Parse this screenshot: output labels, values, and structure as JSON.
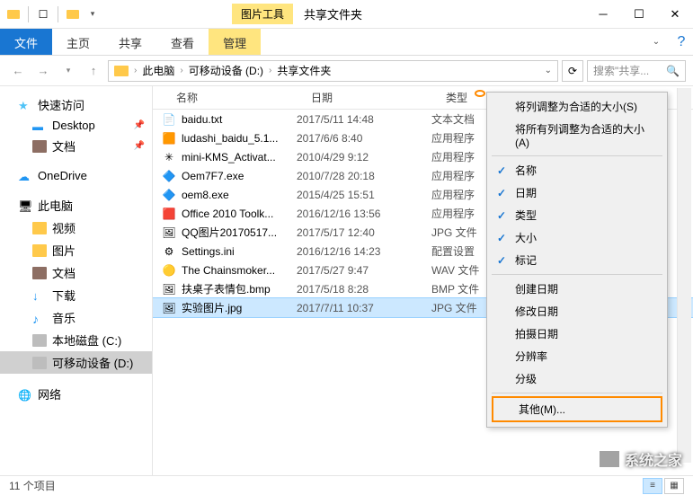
{
  "titlebar": {
    "tool_tab": "图片工具",
    "title": "共享文件夹"
  },
  "tabs": {
    "file": "文件",
    "home": "主页",
    "share": "共享",
    "view": "查看",
    "manage": "管理"
  },
  "addr": {
    "segs": [
      "此电脑",
      "可移动设备 (D:)",
      "共享文件夹"
    ],
    "search_placeholder": "搜索\"共享..."
  },
  "nav": {
    "quick": "快速访问",
    "desktop": "Desktop",
    "docs": "文档",
    "onedrive": "OneDrive",
    "pc": "此电脑",
    "video": "视频",
    "pics": "图片",
    "docs2": "文档",
    "down": "下载",
    "music": "音乐",
    "diskc": "本地磁盘 (C:)",
    "diskd": "可移动设备 (D:)",
    "net": "网络"
  },
  "cols": {
    "name": "名称",
    "date": "日期",
    "type": "类型"
  },
  "files": [
    {
      "name": "baidu.txt",
      "date": "2017/5/11 14:48",
      "type": "文本文档",
      "ico": "txt"
    },
    {
      "name": "ludashi_baidu_5.1...",
      "date": "2017/6/6 8:40",
      "type": "应用程序",
      "ico": "exe1"
    },
    {
      "name": "mini-KMS_Activat...",
      "date": "2010/4/29 9:12",
      "type": "应用程序",
      "ico": "exe2"
    },
    {
      "name": "Oem7F7.exe",
      "date": "2010/7/28 20:18",
      "type": "应用程序",
      "ico": "exe3"
    },
    {
      "name": "oem8.exe",
      "date": "2015/4/25 15:51",
      "type": "应用程序",
      "ico": "exe3"
    },
    {
      "name": "Office 2010 Toolk...",
      "date": "2016/12/16 13:56",
      "type": "应用程序",
      "ico": "exe4"
    },
    {
      "name": "QQ图片20170517...",
      "date": "2017/5/17 12:40",
      "type": "JPG 文件",
      "ico": "img"
    },
    {
      "name": "Settings.ini",
      "date": "2016/12/16 14:23",
      "type": "配置设置",
      "ico": "ini"
    },
    {
      "name": "The Chainsmoker...",
      "date": "2017/5/27 9:47",
      "type": "WAV 文件",
      "ico": "wav"
    },
    {
      "name": "扶桌子表情包.bmp",
      "date": "2017/5/18 8:28",
      "type": "BMP 文件",
      "ico": "img"
    },
    {
      "name": "实验图片.jpg",
      "date": "2017/7/11 10:37",
      "type": "JPG 文件",
      "ico": "img",
      "sel": true
    }
  ],
  "menu": {
    "fit_col": "将列调整为合适的大小(S)",
    "fit_all": "将所有列调整为合适的大小(A)",
    "name": "名称",
    "date": "日期",
    "type": "类型",
    "size": "大小",
    "tags": "标记",
    "created": "创建日期",
    "modified": "修改日期",
    "taken": "拍摄日期",
    "res": "分辨率",
    "rating": "分级",
    "other": "其他(M)..."
  },
  "status": {
    "count": "11 个项目"
  },
  "watermark": "系统之家"
}
